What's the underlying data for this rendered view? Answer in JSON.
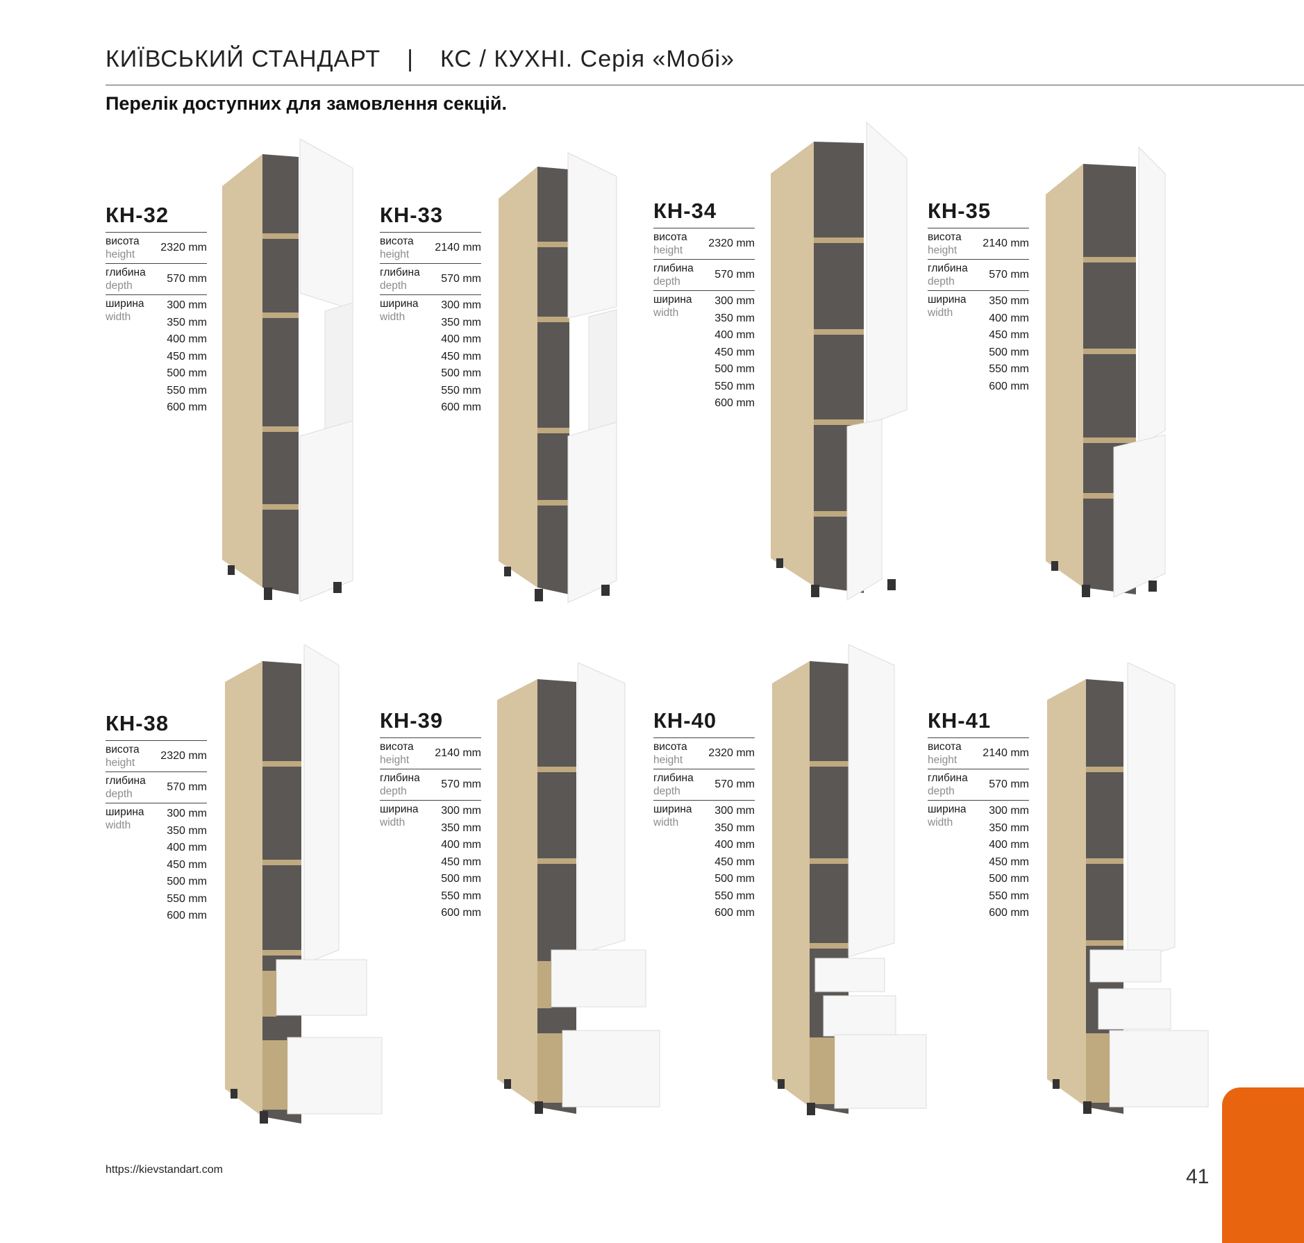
{
  "header": {
    "brand": "КИЇВСЬКИЙ СТАНДАРТ",
    "separator": "|",
    "section": "КС / КУХНІ.  Серія «Мобі»"
  },
  "subtitle": "Перелік доступних для замовлення секцій.",
  "labels": {
    "height_ua": "висота",
    "height_en": "height",
    "depth_ua": "глибина",
    "depth_en": "depth",
    "width_ua": "ширина",
    "width_en": "width"
  },
  "widths": [
    "300 mm",
    "350 mm",
    "400 mm",
    "450 mm",
    "500 mm",
    "550 mm",
    "600 mm"
  ],
  "widths_kh35": [
    "350 mm",
    "400 mm",
    "450 mm",
    "500 mm",
    "550 mm",
    "600 mm"
  ],
  "items": [
    {
      "code": "КН-32",
      "height": "2320 mm",
      "depth": "570 mm"
    },
    {
      "code": "КН-33",
      "height": "2140 mm",
      "depth": "570 mm"
    },
    {
      "code": "КН-34",
      "height": "2320 mm",
      "depth": "570 mm"
    },
    {
      "code": "КН-35",
      "height": "2140 mm",
      "depth": "570 mm"
    },
    {
      "code": "КН-38",
      "height": "2320 mm",
      "depth": "570 mm"
    },
    {
      "code": "КН-39",
      "height": "2140 mm",
      "depth": "570 mm"
    },
    {
      "code": "КН-40",
      "height": "2320 mm",
      "depth": "570 mm"
    },
    {
      "code": "КН-41",
      "height": "2140 mm",
      "depth": "570 mm"
    }
  ],
  "colors": {
    "wood": "#d6c3a0",
    "wood_dark": "#bfa97f",
    "interior": "#5a5755",
    "door": "#f7f7f7",
    "accent": "#e8640f"
  },
  "footer": {
    "url": "https://kievstandart.com",
    "page": "41"
  }
}
